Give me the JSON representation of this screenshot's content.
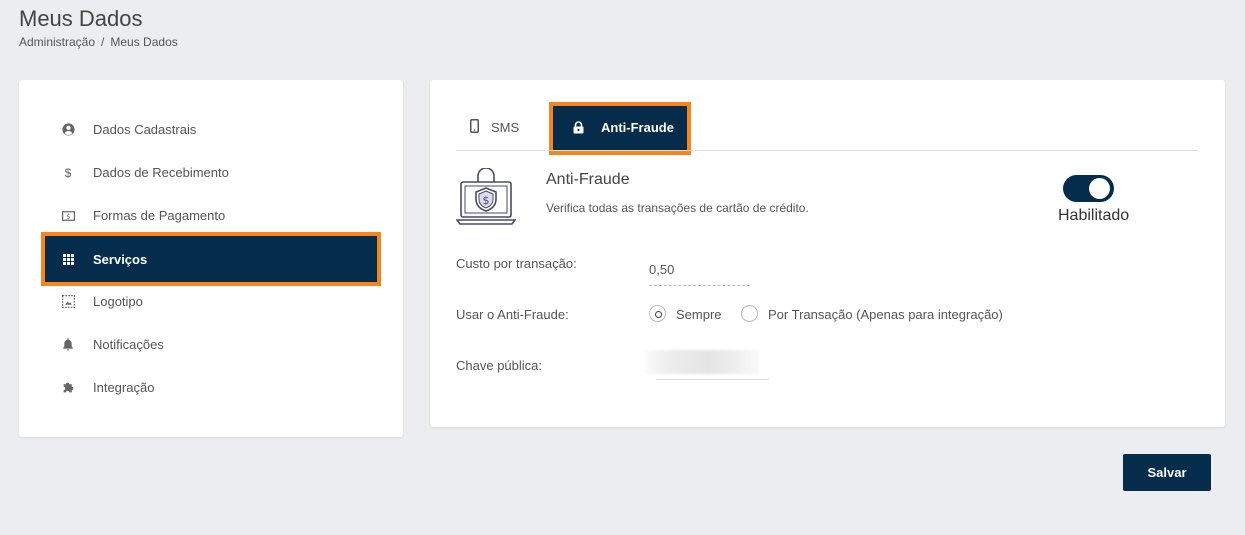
{
  "header": {
    "title": "Meus Dados",
    "breadcrumb": [
      "Administração",
      "/",
      "Meus Dados"
    ]
  },
  "sidebar": {
    "items": [
      {
        "label": "Dados Cadastrais",
        "icon": "user-circle-icon"
      },
      {
        "label": "Dados de Recebimento",
        "icon": "dollar-icon"
      },
      {
        "label": "Formas de Pagamento",
        "icon": "money-bill-icon"
      },
      {
        "label": "Serviços",
        "icon": "grid-icon",
        "active": true
      },
      {
        "label": "Logotipo",
        "icon": "image-icon"
      },
      {
        "label": "Notificações",
        "icon": "bell-icon"
      },
      {
        "label": "Integração",
        "icon": "puzzle-icon"
      }
    ]
  },
  "tabs": {
    "sms": "SMS",
    "anti_fraude": "Anti-Fraude"
  },
  "service": {
    "title": "Anti-Fraude",
    "description": "Verifica todas as transações de cartão de crédito.",
    "toggle_label": "Habilitado",
    "enabled": true
  },
  "form": {
    "cost_label": "Custo por transação:",
    "cost_value": "0,50",
    "usage_label": "Usar o Anti-Fraude:",
    "usage_options": [
      "Sempre",
      "Por Transação (Apenas para integração)"
    ],
    "usage_selected": "Sempre",
    "key_label": "Chave pública:"
  },
  "actions": {
    "save_label": "Salvar"
  },
  "colors": {
    "accent": "#052c4b",
    "highlight": "#f5851f",
    "background": "#ebedf0"
  }
}
